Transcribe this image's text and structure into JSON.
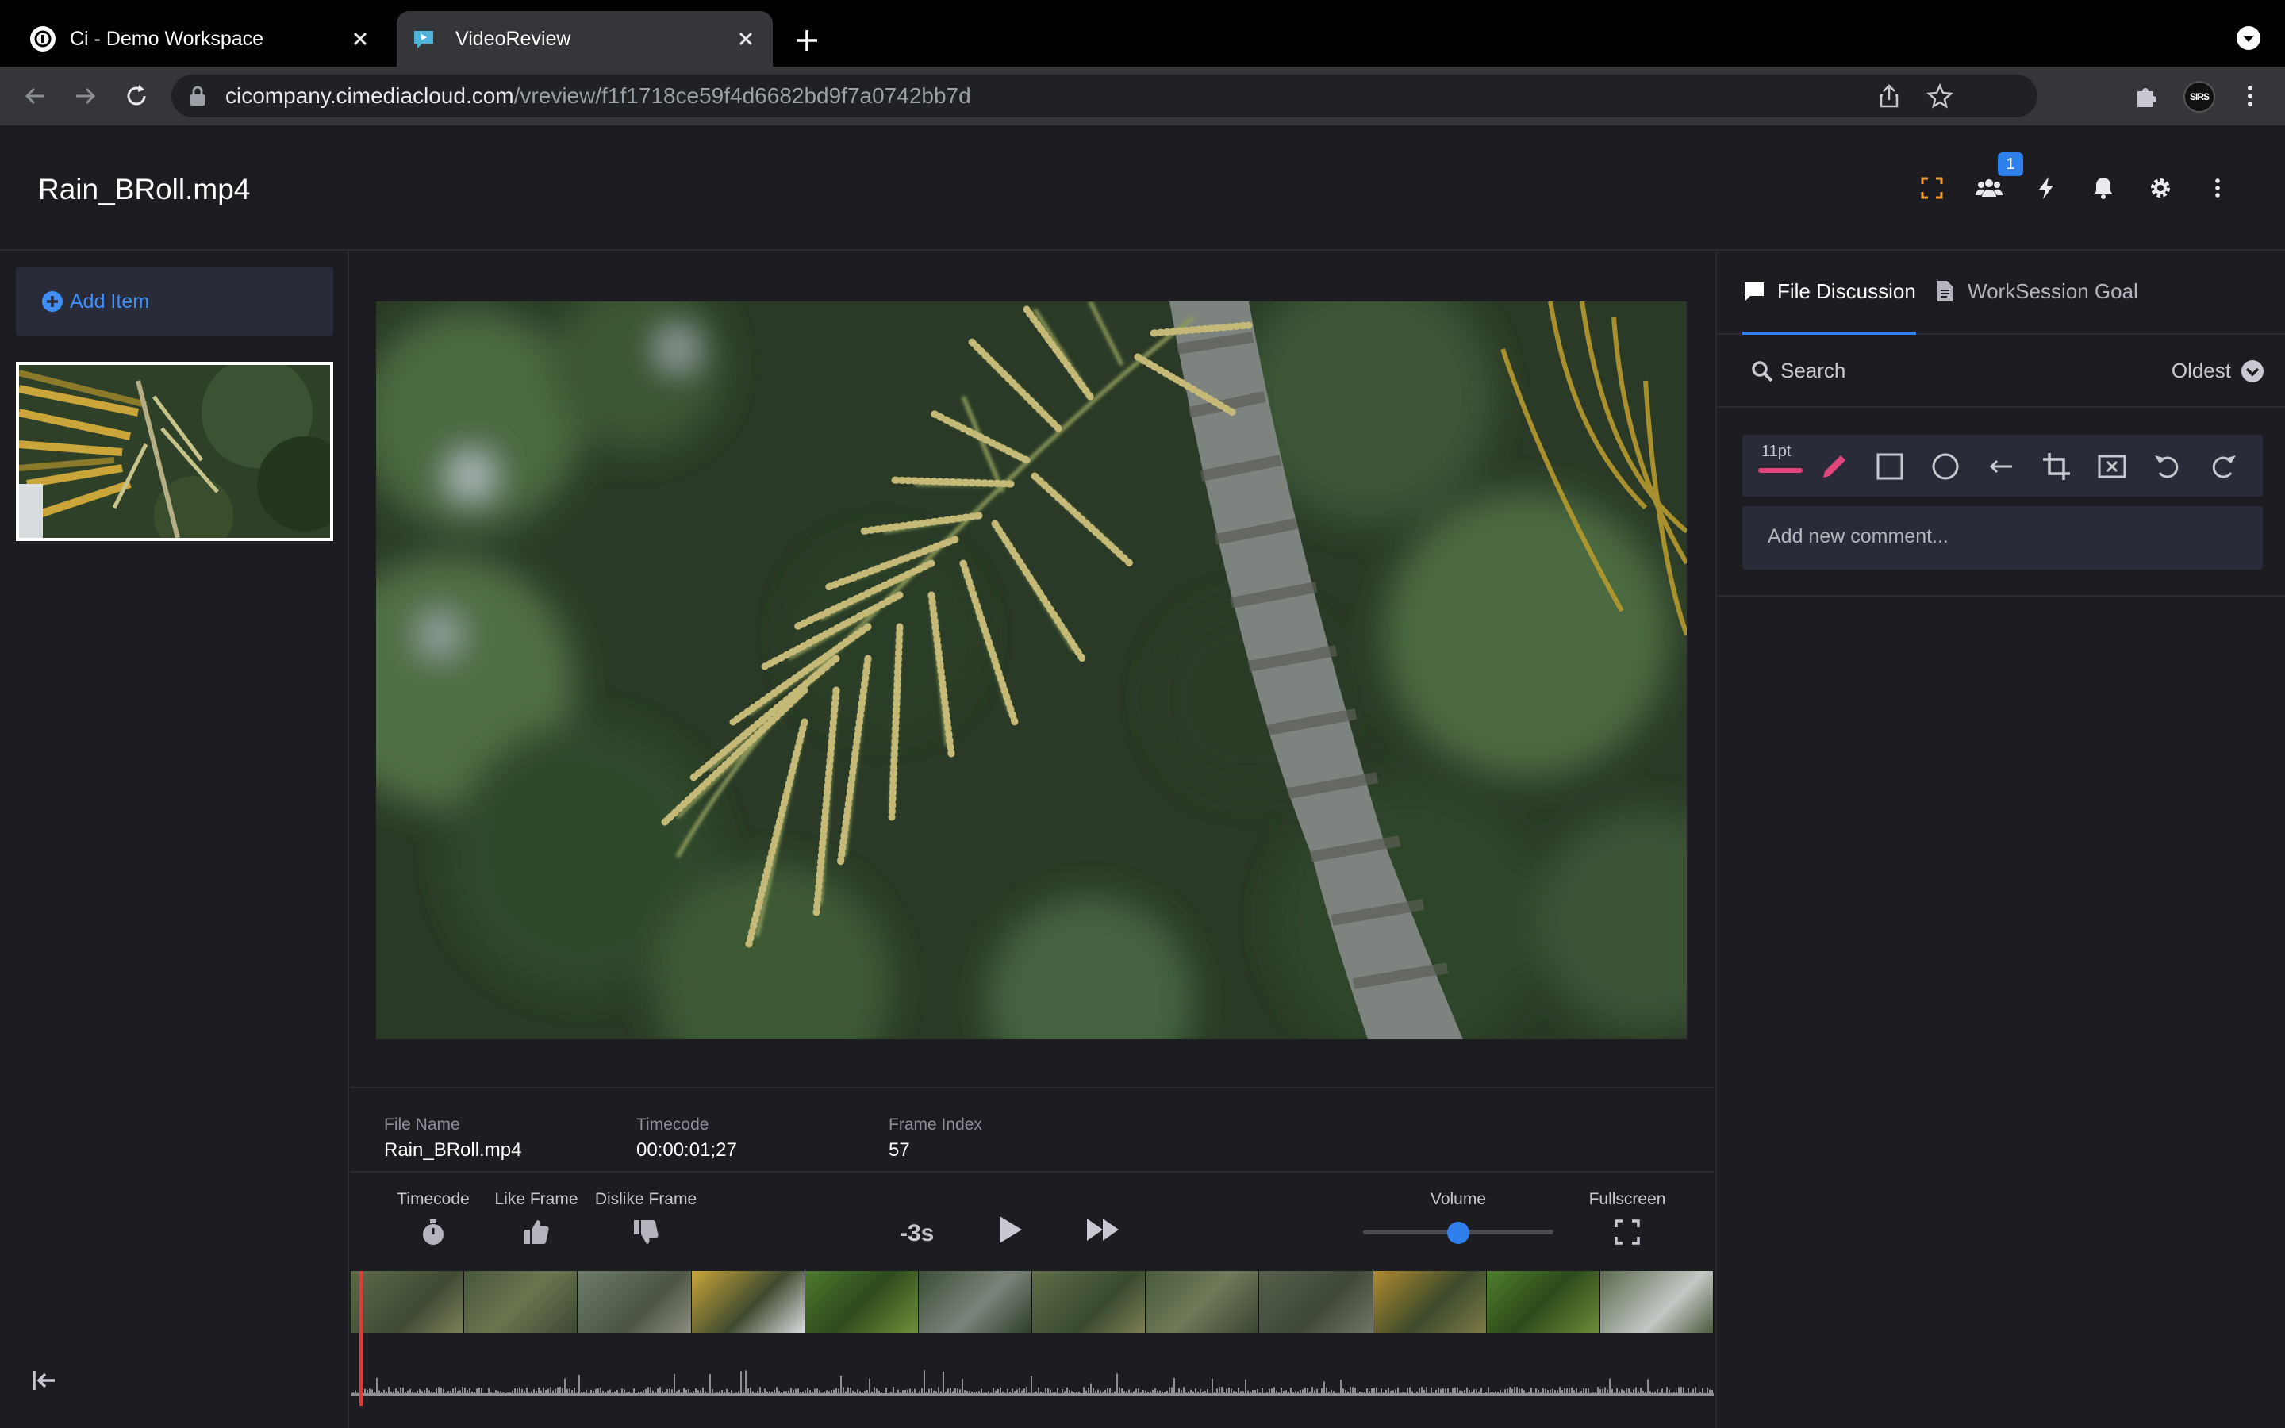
{
  "browser": {
    "tabs": [
      {
        "title": "Ci - Demo Workspace",
        "active": false
      },
      {
        "title": "VideoReview",
        "active": true
      }
    ],
    "url_host": "cicompany.cimediacloud.com",
    "url_path": "/vreview/f1f1718ce59f4d6682bd9f7a0742bb7d",
    "profile_label": "SIRS"
  },
  "header": {
    "file_title": "Rain_BRoll.mp4",
    "users_badge": "1",
    "icons": [
      "focus-icon",
      "users-icon",
      "lightning-icon",
      "bell-icon",
      "gear-icon",
      "more-vert-icon"
    ]
  },
  "left_panel": {
    "add_item_label": "Add Item"
  },
  "player": {
    "info": [
      {
        "key": "File Name",
        "value": "Rain_BRoll.mp4"
      },
      {
        "key": "Timecode",
        "value": "00:00:01;27"
      },
      {
        "key": "Frame Index",
        "value": "57"
      }
    ],
    "controls": {
      "timecode_label": "Timecode",
      "like_label": "Like Frame",
      "dislike_label": "Dislike Frame",
      "skip_back_label": "-3s",
      "volume_label": "Volume",
      "volume_level": 0.5,
      "fullscreen_label": "Fullscreen"
    },
    "playhead_fraction": 0.005
  },
  "right_panel": {
    "tabs": {
      "discussion": "File Discussion",
      "goal": "WorkSession Goal"
    },
    "search_label": "Search",
    "sort_label": "Oldest",
    "pt_size": "11pt",
    "comment_placeholder": "Add new comment...",
    "accent_color": "#2f80ed",
    "pen_color": "#e0457b"
  }
}
